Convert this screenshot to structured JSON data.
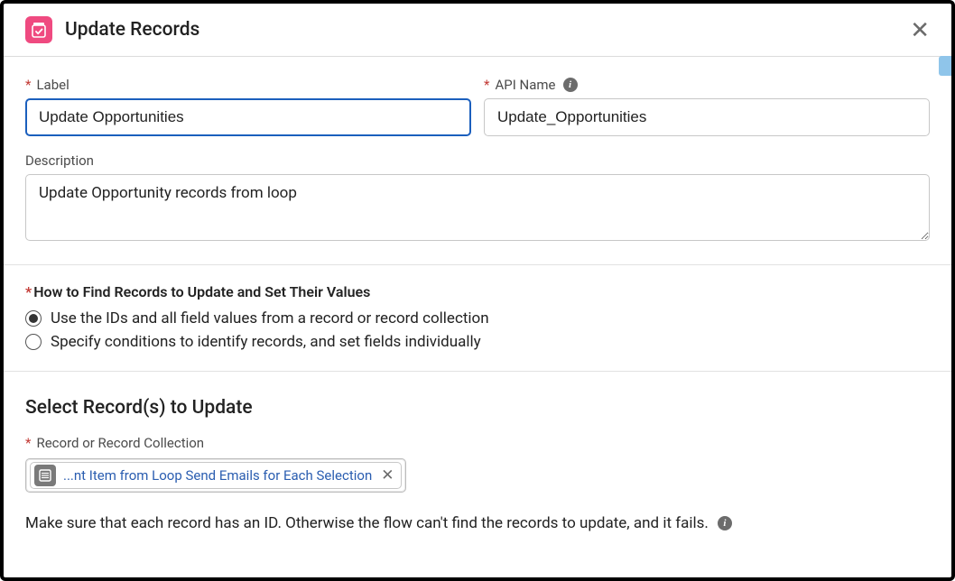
{
  "header": {
    "title": "Update Records"
  },
  "fields": {
    "label_label": "Label",
    "label_value": "Update Opportunities",
    "api_label": "API Name",
    "api_value": "Update_Opportunities",
    "desc_label": "Description",
    "desc_value": "Update Opportunity records from loop"
  },
  "findSection": {
    "title": "How to Find Records to Update and Set Their Values",
    "option1": "Use the IDs and all field values from a record or record collection",
    "option2": "Specify conditions to identify records, and set fields individually"
  },
  "selectSection": {
    "heading": "Select Record(s) to Update",
    "field_label": "Record or Record Collection",
    "pill_text": "...nt Item from Loop Send Emails for Each Selection",
    "helper": "Make sure that each record has an ID. Otherwise the flow can't find the records to update, and it fails."
  }
}
